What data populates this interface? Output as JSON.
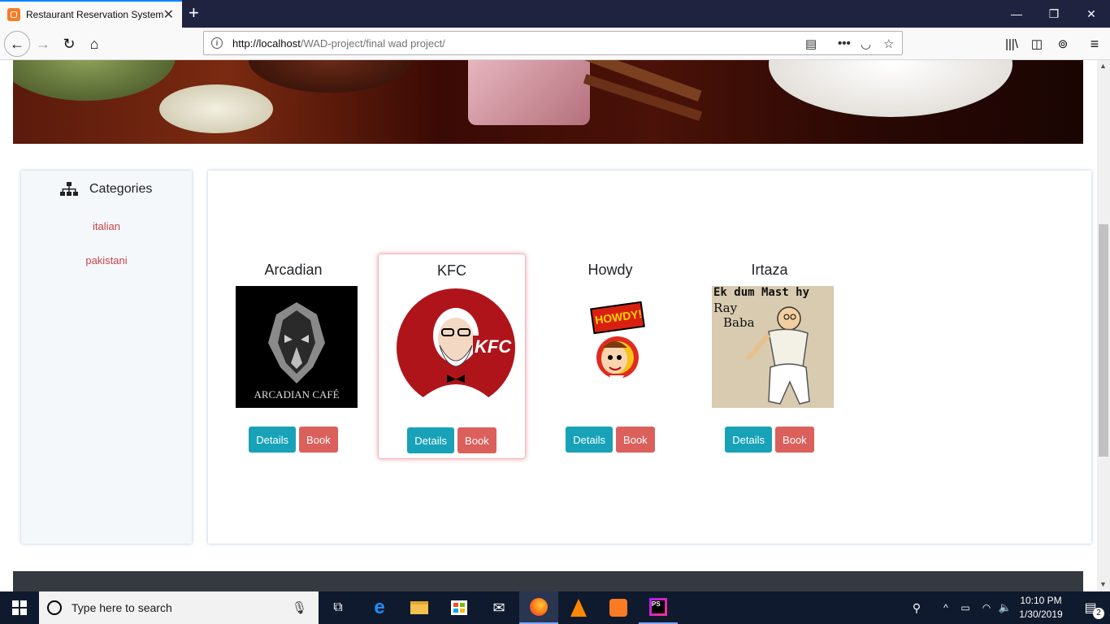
{
  "browser": {
    "tab_title": "Restaurant Reservation System",
    "url_host": "http://localhost",
    "url_path": "/WAD-project/final wad project/"
  },
  "sidebar": {
    "heading": "Categories",
    "items": [
      {
        "label": "italian"
      },
      {
        "label": "pakistani"
      }
    ]
  },
  "restaurants": [
    {
      "name": "Arcadian",
      "logo_text": "ARCADIAN CAFÉ",
      "details_label": "Details",
      "book_label": "Book"
    },
    {
      "name": "KFC",
      "logo_text": "KFC",
      "details_label": "Details",
      "book_label": "Book"
    },
    {
      "name": "Howdy",
      "logo_text": "HOWDY!",
      "details_label": "Details",
      "book_label": "Book"
    },
    {
      "name": "Irtaza",
      "logo_text_line1": "Ek dum Mast hy",
      "logo_text_line2": "Ray",
      "logo_text_line3": "Baba",
      "details_label": "Details",
      "book_label": "Book"
    }
  ],
  "taskbar": {
    "search_placeholder": "Type here to search",
    "time": "10:10 PM",
    "date": "1/30/2019",
    "notification_count": "2"
  },
  "colors": {
    "details_button": "#17a2b8",
    "book_button": "#d9534f",
    "category_link": "#c9434a",
    "footer": "#343a40"
  }
}
